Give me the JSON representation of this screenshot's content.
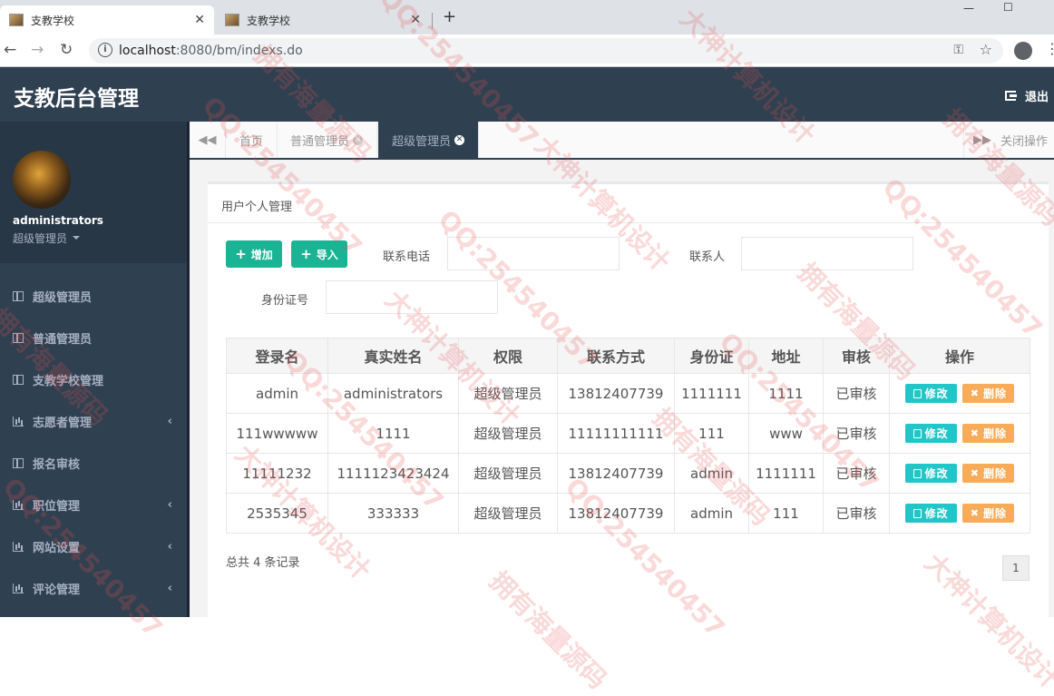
{
  "browser": {
    "tabs": [
      {
        "title": "支教学校",
        "active": true
      },
      {
        "title": "支教学校",
        "active": false
      }
    ],
    "url_host": "localhost",
    "url_rest": ":8080/bm/indexs.do"
  },
  "app": {
    "title": "支教后台管理",
    "logout_label": "退出"
  },
  "profile": {
    "name": "administrators",
    "role": "超级管理员"
  },
  "sidebar": {
    "items": [
      {
        "label": "超级管理员",
        "icon": "grid-icon",
        "has_submenu": false
      },
      {
        "label": "普通管理员",
        "icon": "grid-icon",
        "has_submenu": false
      },
      {
        "label": "支教学校管理",
        "icon": "grid-icon",
        "has_submenu": false
      },
      {
        "label": "志愿者管理",
        "icon": "bar-chart-icon",
        "has_submenu": true
      },
      {
        "label": "报名审核",
        "icon": "grid-icon",
        "has_submenu": false
      },
      {
        "label": "职位管理",
        "icon": "bar-chart-icon",
        "has_submenu": true
      },
      {
        "label": "网站设置",
        "icon": "bar-chart-icon",
        "has_submenu": true
      },
      {
        "label": "评论管理",
        "icon": "bar-chart-icon",
        "has_submenu": true
      }
    ]
  },
  "content_tabs": {
    "items": [
      {
        "label": "首页",
        "closable": false,
        "active": false
      },
      {
        "label": "普通管理员",
        "closable": true,
        "active": false
      },
      {
        "label": "超级管理员",
        "closable": true,
        "active": true
      }
    ],
    "close_ops_label": "关闭操作"
  },
  "panel": {
    "title": "用户个人管理",
    "add_label": "增加",
    "import_label": "导入",
    "filters": {
      "phone_label": "联系电话",
      "contact_label": "联系人",
      "idcard_label": "身份证号"
    }
  },
  "table": {
    "columns": [
      "登录名",
      "真实姓名",
      "权限",
      "联系方式",
      "身份证",
      "地址",
      "审核",
      "操作"
    ],
    "rows": [
      [
        "admin",
        "administrators",
        "超级管理员",
        "13812407739",
        "1111111",
        "1111",
        "已审核"
      ],
      [
        "111wwwww",
        "1111",
        "超级管理员",
        "11111111111",
        "111",
        "www",
        "已审核"
      ],
      [
        "11111232",
        "1111123423424",
        "超级管理员",
        "13812407739",
        "admin",
        "1111111",
        "已审核"
      ],
      [
        "2535345",
        "333333",
        "超级管理员",
        "13812407739",
        "admin",
        "111",
        "已审核"
      ]
    ],
    "edit_label": "修改",
    "delete_label": "删除"
  },
  "footer": {
    "total_text": "总共 4 条记录",
    "page": "1"
  },
  "watermark": {
    "texts": [
      "大神计算机设计",
      "QQ:254540457",
      "拥有海量源码"
    ],
    "color": "#e65050"
  },
  "colors": {
    "header_bg": "#2f4050",
    "primary": "#1ab394",
    "info": "#23c6c8",
    "warning": "#f8ac59"
  }
}
